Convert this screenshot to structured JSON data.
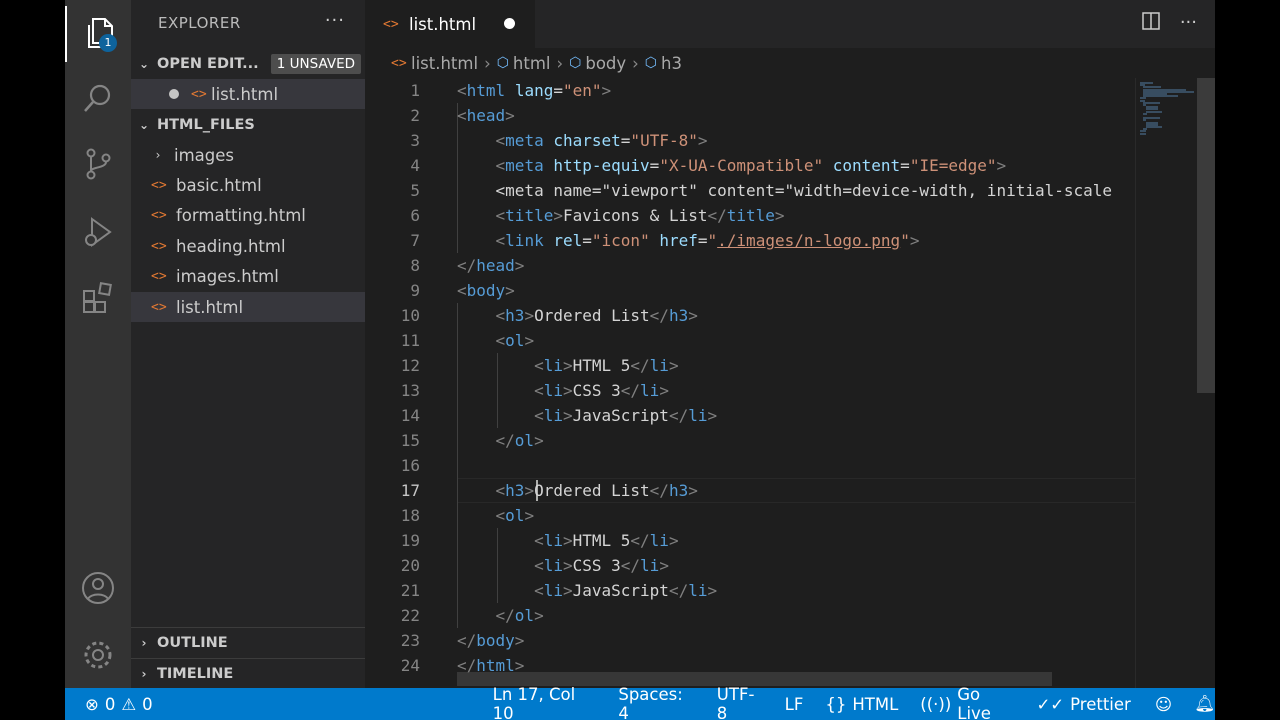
{
  "explorer": {
    "title": "EXPLORER",
    "more": "···",
    "activity_badge": "1",
    "open_editors": {
      "label": "OPEN EDIT...",
      "unsaved_badge": "1 UNSAVED",
      "files": [
        {
          "name": "list.html"
        }
      ]
    },
    "workspace": {
      "label": "HTML_FILES",
      "items": [
        {
          "name": "images",
          "type": "folder"
        },
        {
          "name": "basic.html",
          "type": "file"
        },
        {
          "name": "formatting.html",
          "type": "file"
        },
        {
          "name": "heading.html",
          "type": "file"
        },
        {
          "name": "images.html",
          "type": "file"
        },
        {
          "name": "list.html",
          "type": "file",
          "selected": true
        }
      ]
    },
    "outline_label": "OUTLINE",
    "timeline_label": "TIMELINE"
  },
  "editor": {
    "tab_label": "list.html",
    "breadcrumb": [
      "list.html",
      "html",
      "body",
      "h3"
    ],
    "current_line": 17,
    "lines": [
      {
        "n": "1",
        "code": "<html lang=\"en\">"
      },
      {
        "n": "2",
        "code": "<head>"
      },
      {
        "n": "3",
        "code": "    <meta charset=\"UTF-8\">"
      },
      {
        "n": "4",
        "code": "    <meta http-equiv=\"X-UA-Compatible\" content=\"IE=edge\">"
      },
      {
        "n": "5",
        "code": "    <meta name=\"viewport\" content=\"width=device-width, initial-scale"
      },
      {
        "n": "6",
        "code": "    <title>Favicons & List</title>"
      },
      {
        "n": "7",
        "code": "    <link rel=\"icon\" href=\"./images/n-logo.png\">"
      },
      {
        "n": "8",
        "code": "</head>"
      },
      {
        "n": "9",
        "code": "<body>"
      },
      {
        "n": "10",
        "code": "    <h3>Ordered List</h3>"
      },
      {
        "n": "11",
        "code": "    <ol>"
      },
      {
        "n": "12",
        "code": "        <li>HTML 5</li>"
      },
      {
        "n": "13",
        "code": "        <li>CSS 3</li>"
      },
      {
        "n": "14",
        "code": "        <li>JavaScript</li>"
      },
      {
        "n": "15",
        "code": "    </ol>"
      },
      {
        "n": "16",
        "code": ""
      },
      {
        "n": "17",
        "code": "    <h3>Ordered List</h3>"
      },
      {
        "n": "18",
        "code": "    <ol>"
      },
      {
        "n": "19",
        "code": "        <li>HTML 5</li>"
      },
      {
        "n": "20",
        "code": "        <li>CSS 3</li>"
      },
      {
        "n": "21",
        "code": "        <li>JavaScript</li>"
      },
      {
        "n": "22",
        "code": "    </ol>"
      },
      {
        "n": "23",
        "code": "</body>"
      },
      {
        "n": "24",
        "code": "</html>"
      }
    ]
  },
  "status": {
    "errors": "0",
    "warnings": "0",
    "position": "Ln 17, Col 10",
    "spaces": "Spaces: 4",
    "encoding": "UTF-8",
    "eol": "LF",
    "language": "HTML",
    "live": "Go Live",
    "prettier": "Prettier"
  },
  "colors": {
    "status_bar": "#007acc",
    "tag": "#569cd6",
    "attr_name": "#9cdcfe",
    "attr_value": "#ce9178",
    "html_icon": "#e37933"
  }
}
